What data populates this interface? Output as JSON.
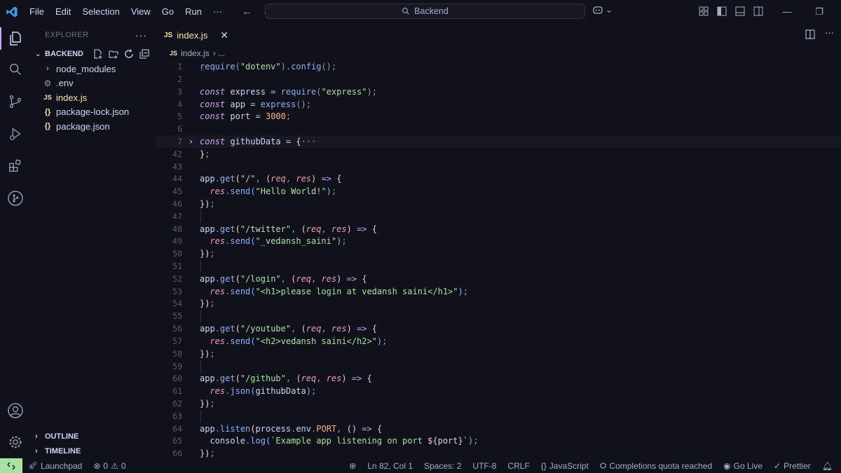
{
  "menu": {
    "items": [
      "File",
      "Edit",
      "Selection",
      "View",
      "Go",
      "Run"
    ],
    "more": "···"
  },
  "search": {
    "label": "Backend"
  },
  "sidebar": {
    "header": "EXPLORER",
    "section": "BACKEND",
    "tree": [
      {
        "label": "node_modules",
        "icon": "chevron-right-icon"
      },
      {
        "label": ".env",
        "icon": "gear-icon"
      },
      {
        "label": "index.js",
        "icon": "js-file-icon"
      },
      {
        "label": "package-lock.json",
        "icon": "json-file-icon"
      },
      {
        "label": "package.json",
        "icon": "json-file-icon"
      }
    ],
    "outline": "OUTLINE",
    "timeline": "TIMELINE"
  },
  "tab": {
    "badge": "JS",
    "label": "index.js"
  },
  "breadcrumb": {
    "badge": "JS",
    "file": "index.js",
    "rest": "› ..."
  },
  "code_lines": [
    "1",
    "2",
    "3",
    "4",
    "5",
    "6",
    "7",
    "42",
    "43",
    "44",
    "45",
    "46",
    "47",
    "48",
    "49",
    "50",
    "51",
    "52",
    "53",
    "54",
    "55",
    "56",
    "57",
    "58",
    "59",
    "60",
    "61",
    "62",
    "63",
    "64",
    "65",
    "66"
  ],
  "status": {
    "launchpad": "Launchpad",
    "errors": "0",
    "warnings": "0",
    "position": "Ln 82, Col 1",
    "spaces": "Spaces: 2",
    "encoding": "UTF-8",
    "eol": "CRLF",
    "language": "JavaScript",
    "completions": "Completions quota reached",
    "golive": "Go Live",
    "prettier": "Prettier"
  },
  "colors": {
    "background": "#11111b",
    "accent": "#cba6f7",
    "remote": "#a6e3a1",
    "js_badge": "#f9e2af"
  }
}
